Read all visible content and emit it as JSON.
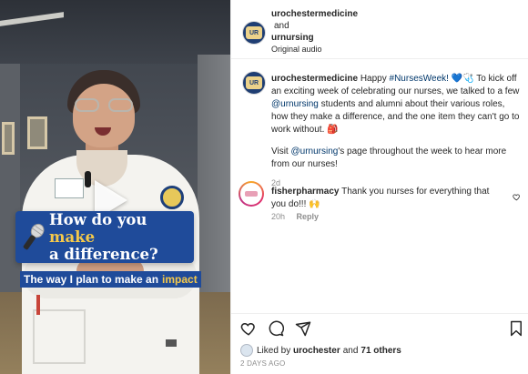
{
  "video": {
    "question_prefix": "How do you",
    "question_highlight": "make",
    "question_line2": "a difference?",
    "caption_prefix": "The way I plan to make an",
    "caption_highlight": "impact"
  },
  "header": {
    "account1": "urochestermedicine",
    "conjunction": "and",
    "account2": "urnursing",
    "audio": "Original audio"
  },
  "post": {
    "author": "urochestermedicine",
    "text_part1": "Happy",
    "hashtag": "#NursesWeek!",
    "emojis1": "💙🩺",
    "text_part2": "To kick off an exciting week of celebrating our nurses, we talked to a few",
    "mention1": "@urnursing",
    "text_part3": "students and alumni about their various roles, how they make a difference, and the one item they can't go to work without.",
    "emoji_bag": "🎒",
    "text_visit": "Visit",
    "mention2": "@urnursing",
    "text_part4": "'s page throughout the week to hear more from our nurses!",
    "age": "2d"
  },
  "comment": {
    "author": "fisherpharmacy",
    "text": "Thank you nurses for everything that you do!!! 🙌",
    "age": "20h",
    "reply_label": "Reply"
  },
  "likes": {
    "prefix": "Liked by",
    "user": "urochester",
    "conjunction": "and",
    "others": "71 others"
  },
  "timestamp": "2 DAYS AGO",
  "icons": [
    "heart-icon",
    "comment-icon",
    "share-icon",
    "bookmark-icon",
    "microphone-icon",
    "play-icon"
  ],
  "colors": {
    "brand_blue": "#1f4b9a",
    "highlight": "#f5c94a",
    "link": "#00376b"
  }
}
